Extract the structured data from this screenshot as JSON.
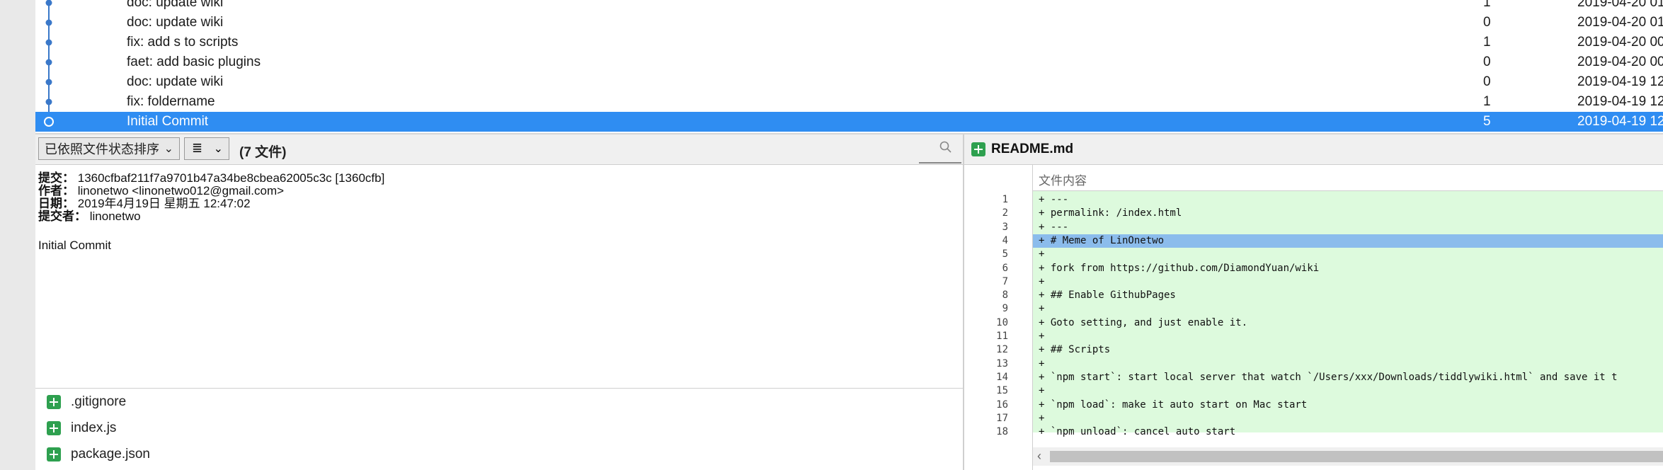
{
  "commits": [
    {
      "message": "doc: update wiki",
      "count": "1",
      "date": "2019-04-20 01"
    },
    {
      "message": "doc: update wiki",
      "count": "0",
      "date": "2019-04-20 01"
    },
    {
      "message": "fix: add s to scripts",
      "count": "1",
      "date": "2019-04-20 00"
    },
    {
      "message": "faet: add basic plugins",
      "count": "0",
      "date": "2019-04-20 00"
    },
    {
      "message": "doc: update wiki",
      "count": "0",
      "date": "2019-04-19 12"
    },
    {
      "message": "fix: foldername",
      "count": "1",
      "date": "2019-04-19 12"
    },
    {
      "message": "Initial Commit",
      "count": "5",
      "date": "2019-04-19 12"
    }
  ],
  "toolbar": {
    "sort_label": "已依照文件状态排序",
    "file_count": "(7 文件)",
    "view_icon": "list-icon",
    "search_icon": "search-icon"
  },
  "details": {
    "commit_label": "提交：",
    "commit_value": "1360cfbaf211f7a9701b47a34be8cbea62005c3c [1360cfb]",
    "author_label": "作者：",
    "author_value": "linonetwo <linonetwo012@gmail.com>",
    "date_label": "日期：",
    "date_value": "2019年4月19日 星期五 12:47:02",
    "committer_label": "提交者：",
    "committer_value": "linonetwo",
    "message": "Initial Commit"
  },
  "files": [
    ".gitignore",
    "index.js",
    "package.json"
  ],
  "diff": {
    "filename": "README.md",
    "column_header": "文件内容",
    "lines": [
      {
        "n": "1",
        "text": "+ ---"
      },
      {
        "n": "2",
        "text": "+ permalink: /index.html"
      },
      {
        "n": "3",
        "text": "+ ---"
      },
      {
        "n": "4",
        "text": "+ # Meme of LinOnetwo"
      },
      {
        "n": "5",
        "text": "+"
      },
      {
        "n": "6",
        "text": "+ fork from https://github.com/DiamondYuan/wiki"
      },
      {
        "n": "7",
        "text": "+"
      },
      {
        "n": "8",
        "text": "+ ## Enable GithubPages"
      },
      {
        "n": "9",
        "text": "+"
      },
      {
        "n": "10",
        "text": "+ Goto setting, and just enable it."
      },
      {
        "n": "11",
        "text": "+"
      },
      {
        "n": "12",
        "text": "+ ## Scripts"
      },
      {
        "n": "13",
        "text": "+"
      },
      {
        "n": "14",
        "text": "+ `npm start`: start local server that watch `/Users/xxx/Downloads/tiddlywiki.html` and save it t"
      },
      {
        "n": "15",
        "text": "+"
      },
      {
        "n": "16",
        "text": "+ `npm load`: make it auto start on Mac start"
      },
      {
        "n": "17",
        "text": "+"
      },
      {
        "n": "18",
        "text": "+ `npm unload`: cancel auto start"
      }
    ]
  }
}
